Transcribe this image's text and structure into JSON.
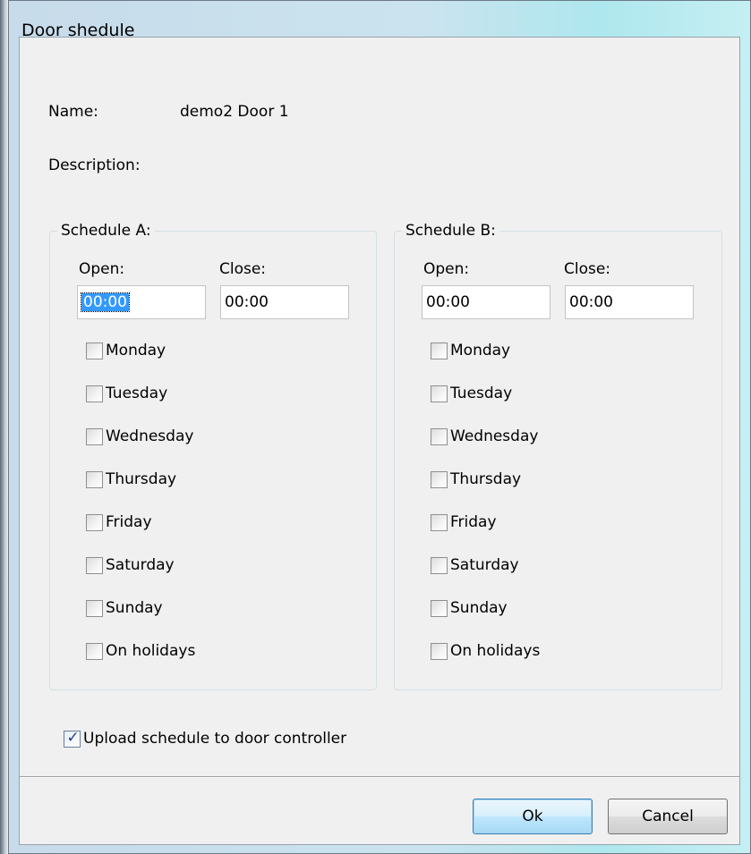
{
  "window": {
    "title": "Door shedule"
  },
  "fields": {
    "name_label": "Name:",
    "name_value": "demo2 Door 1",
    "description_label": "Description:"
  },
  "schedule_a": {
    "title": "Schedule A:",
    "open_label": "Open:",
    "close_label": "Close:",
    "open_value": "00:00",
    "close_value": "00:00",
    "days": [
      {
        "label": "Monday",
        "checked": false
      },
      {
        "label": "Tuesday",
        "checked": false
      },
      {
        "label": "Wednesday",
        "checked": false
      },
      {
        "label": "Thursday",
        "checked": false
      },
      {
        "label": "Friday",
        "checked": false
      },
      {
        "label": "Saturday",
        "checked": false
      },
      {
        "label": "Sunday",
        "checked": false
      },
      {
        "label": "On holidays",
        "checked": false
      }
    ]
  },
  "schedule_b": {
    "title": "Schedule B:",
    "open_label": "Open:",
    "close_label": "Close:",
    "open_value": "00:00",
    "close_value": "00:00",
    "days": [
      {
        "label": "Monday",
        "checked": false
      },
      {
        "label": "Tuesday",
        "checked": false
      },
      {
        "label": "Wednesday",
        "checked": false
      },
      {
        "label": "Thursday",
        "checked": false
      },
      {
        "label": "Friday",
        "checked": false
      },
      {
        "label": "Saturday",
        "checked": false
      },
      {
        "label": "Sunday",
        "checked": false
      },
      {
        "label": "On holidays",
        "checked": false
      }
    ]
  },
  "upload": {
    "label": "Upload schedule to door controller",
    "checked": true
  },
  "buttons": {
    "ok": "Ok",
    "cancel": "Cancel"
  },
  "colors": {
    "selection": "#3399ff",
    "default_button_border": "#3c7fb1"
  }
}
